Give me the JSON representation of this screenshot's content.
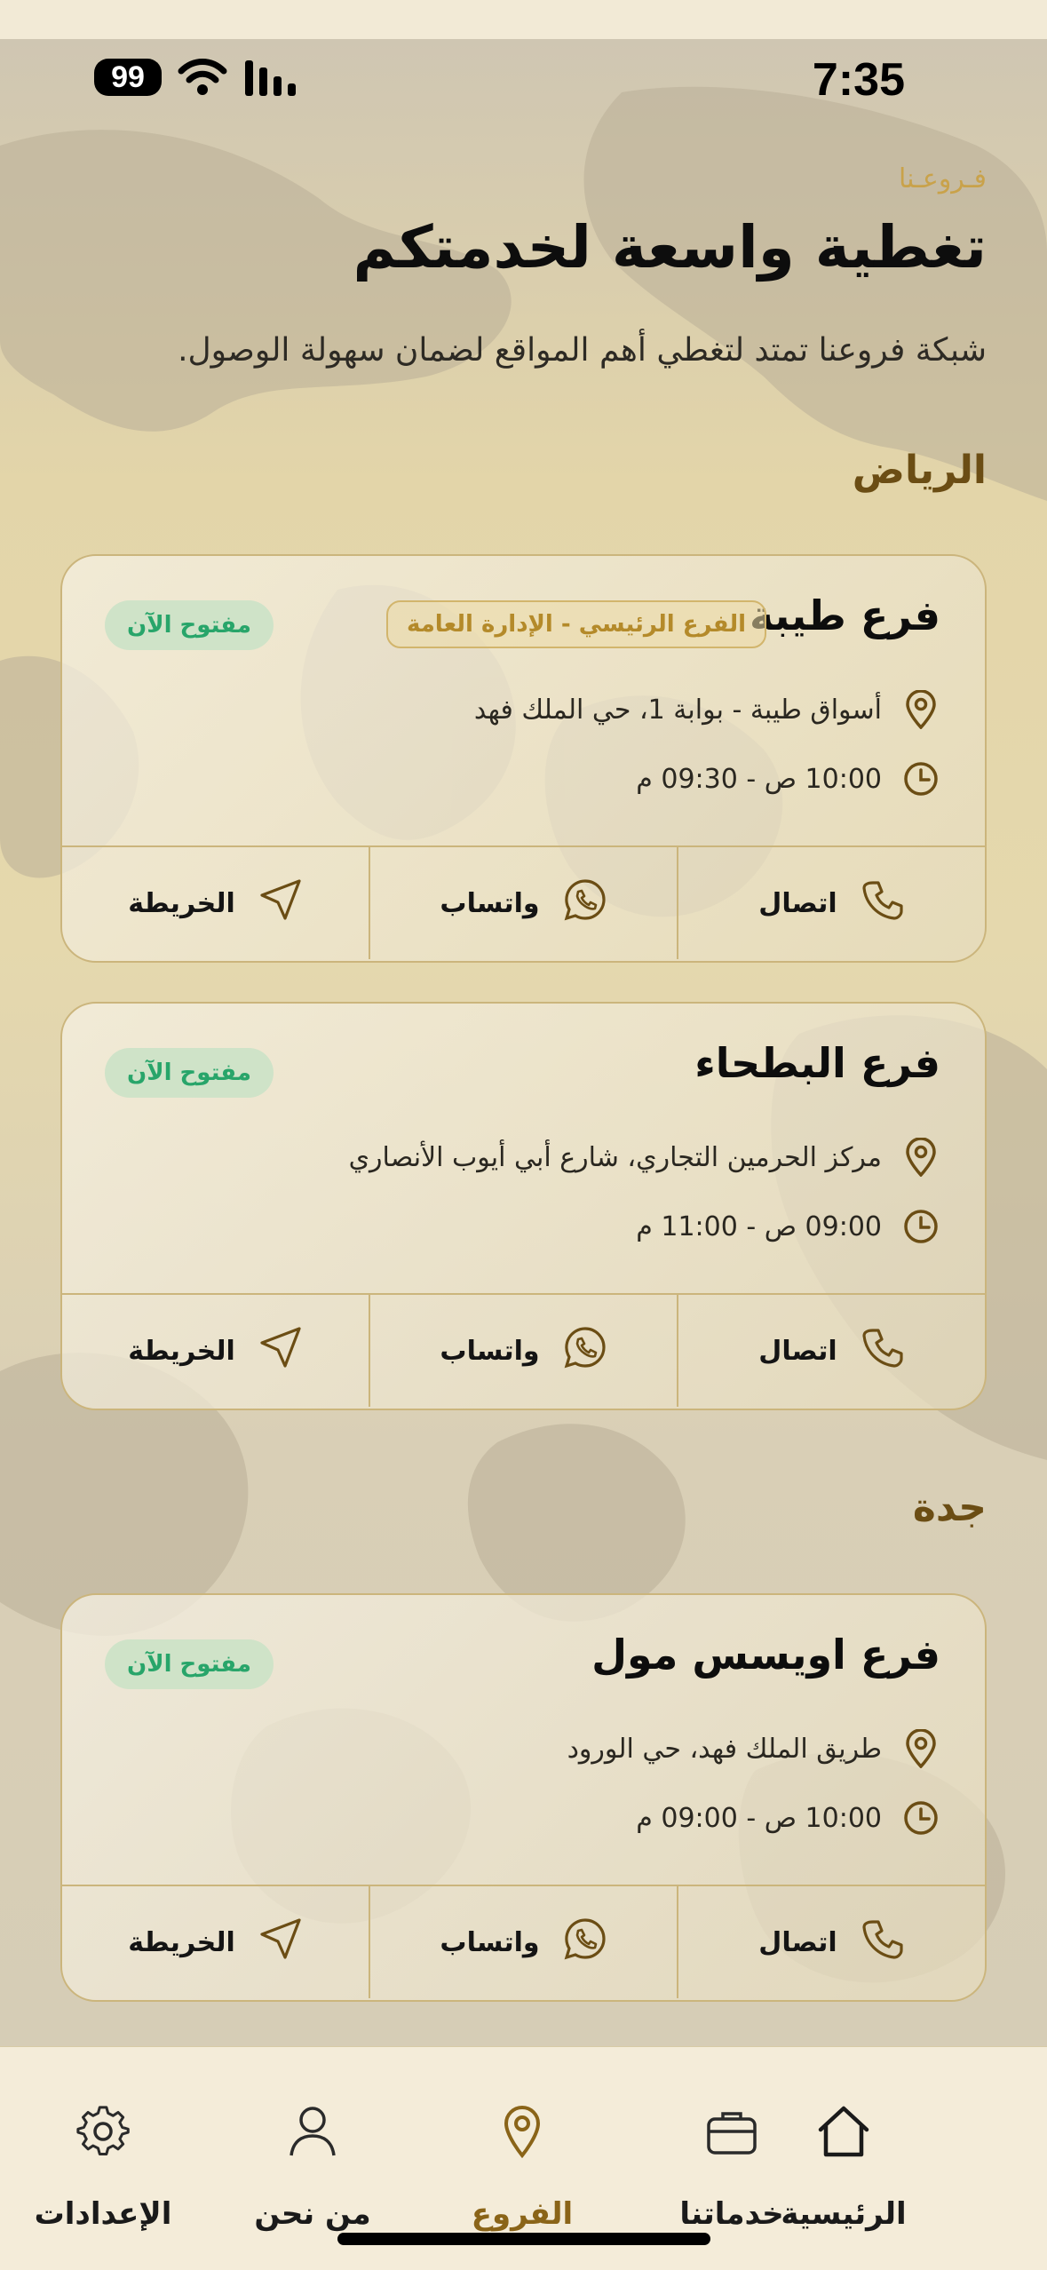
{
  "status_bar": {
    "time": "7:35",
    "battery": "99"
  },
  "header": {
    "eyebrow": "فـروعـنا",
    "title": "تغطية واسعة لخدمتكم",
    "subtitle": "شبكة فروعنا تمتد لتغطي أهم المواقع لضمان سهولة الوصول."
  },
  "cities": [
    {
      "name": "الرياض",
      "branches": [
        {
          "name": "فرع طيبة",
          "badge": "الفرع الرئيسي - الإدارة العامة",
          "status": "مفتوح الآن",
          "address": "أسواق طيبة - بوابة 1، حي الملك فهد",
          "hours": "10:00 ص - 09:30 م"
        },
        {
          "name": "فرع البطحاء",
          "status": "مفتوح الآن",
          "address": "مركز الحرمين التجاري، شارع أبي أيوب الأنصاري",
          "hours": "09:00 ص - 11:00 م"
        }
      ]
    },
    {
      "name": "جدة",
      "branches": [
        {
          "name": "فرع اويسس مول",
          "status": "مفتوح الآن",
          "address": "طريق الملك فهد، حي الورود",
          "hours": "10:00 ص - 09:00 م"
        }
      ]
    }
  ],
  "actions": {
    "call": "اتصال",
    "whatsapp": "واتساب",
    "map": "الخريطة"
  },
  "tabbar": {
    "home": "الرئيسية",
    "services": "خدماتنا",
    "branches": "الفروع",
    "about": "من نحن",
    "settings": "الإعدادات"
  },
  "colors": {
    "accent": "#8a6418",
    "gold": "#c9a24a",
    "open_green": "#28a56a"
  }
}
